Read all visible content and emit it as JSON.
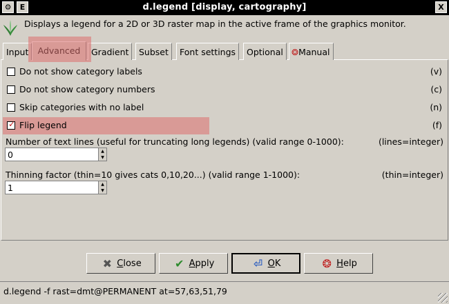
{
  "window": {
    "title": "d.legend [display, cartography]",
    "menu_button": "E",
    "close_button": "X"
  },
  "description": "Displays a legend for a 2D or 3D raster map in the active frame of the graphics monitor.",
  "tabs": [
    {
      "label": "Input"
    },
    {
      "label": "Advanced"
    },
    {
      "label": "Gradient"
    },
    {
      "label": "Subset"
    },
    {
      "label": "Font settings"
    },
    {
      "label": "Optional"
    },
    {
      "label": "Manual"
    }
  ],
  "active_tab": "Advanced",
  "options": [
    {
      "label": "Do not show category labels",
      "flag": "(v)",
      "checked": false
    },
    {
      "label": "Do not show category numbers",
      "flag": "(c)",
      "checked": false
    },
    {
      "label": "Skip categories with no label",
      "flag": "(n)",
      "checked": false
    },
    {
      "label": "Flip legend",
      "flag": "(f)",
      "checked": true,
      "check_mark": "☑"
    }
  ],
  "fields": [
    {
      "label": "Number of text lines (useful for truncating long legends) (valid range 0-1000):",
      "key": "(lines=integer)",
      "value": "0"
    },
    {
      "label": "Thinning factor (thin=10 gives cats 0,10,20...) (valid range 1-1000):",
      "key": "(thin=integer)",
      "value": "1"
    }
  ],
  "buttons": {
    "close": {
      "label_first": "C",
      "label_rest": "lose"
    },
    "apply": {
      "label_first": "A",
      "label_rest": "pply"
    },
    "ok": {
      "label_first": "O",
      "label_rest": "K"
    },
    "help": {
      "label_first": "H",
      "label_rest": "elp"
    }
  },
  "status_text": "d.legend -f rast=dmt@PERMANENT at=57,63,51,79",
  "colors": {
    "highlight": "#dc6e6e",
    "checkmark": "#c02020"
  }
}
